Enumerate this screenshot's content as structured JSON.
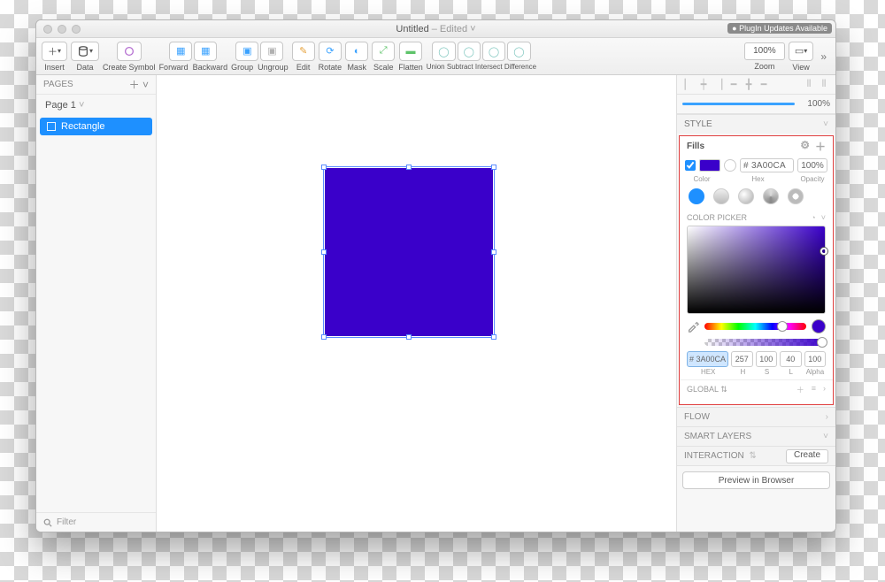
{
  "window": {
    "title": "Untitled",
    "edited": " – Edited",
    "plugin_badge": "● PlugIn Updates Available"
  },
  "toolbar": {
    "insert": "Insert",
    "data": "Data",
    "create_symbol": "Create Symbol",
    "forward": "Forward",
    "backward": "Backward",
    "group": "Group",
    "ungroup": "Ungroup",
    "edit": "Edit",
    "rotate": "Rotate",
    "mask": "Mask",
    "scale": "Scale",
    "flatten": "Flatten",
    "union": "Union",
    "subtract": "Subtract",
    "intersect": "Intersect",
    "difference": "Difference",
    "zoom": "Zoom",
    "zoom_value": "100%",
    "view": "View"
  },
  "pages": {
    "header": "PAGES",
    "page": "Page 1",
    "layer": "Rectangle",
    "filter": "Filter"
  },
  "inspector": {
    "opacity": "100%",
    "style": "STYLE",
    "fills_label": "Fills",
    "fill": {
      "hex_display": "# 3A00CA",
      "opacity": "100%",
      "color_label": "Color",
      "hex_label": "Hex",
      "opacity_label": "Opacity"
    },
    "color_picker": "COLOR PICKER",
    "hsl": {
      "hex": "# 3A00CA",
      "h": "257",
      "s": "100",
      "l": "40",
      "a": "100",
      "hex_l": "HEX",
      "h_l": "H",
      "s_l": "S",
      "l_l": "L",
      "a_l": "Alpha"
    },
    "global": "GLOBAL",
    "flow": "FLOW",
    "smart": "SMART LAYERS",
    "interaction": "INTERACTION",
    "create": "Create",
    "preview": "Preview in Browser"
  },
  "shape": {
    "fill": "#3A00CA"
  }
}
